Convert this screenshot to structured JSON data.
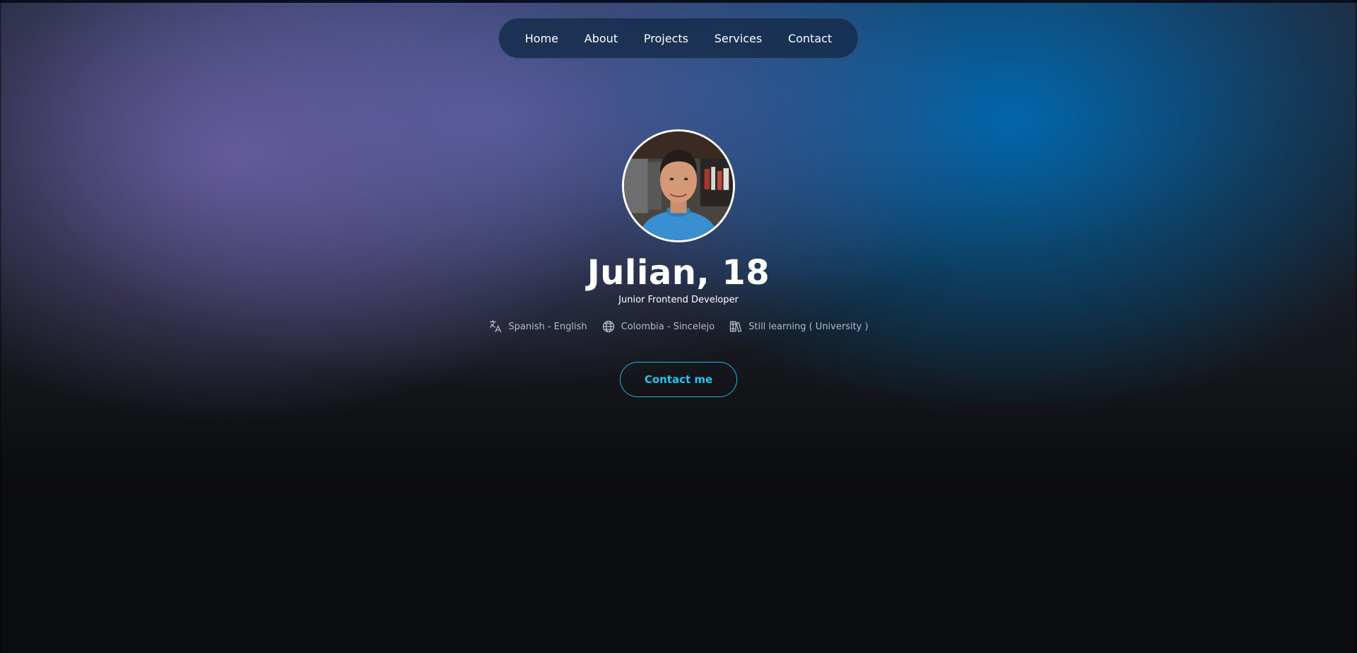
{
  "nav": {
    "items": [
      {
        "label": "Home"
      },
      {
        "label": "About"
      },
      {
        "label": "Projects"
      },
      {
        "label": "Services"
      },
      {
        "label": "Contact"
      }
    ]
  },
  "profile": {
    "name": "Julian, 18",
    "role": "Junior Frontend Developer",
    "info": [
      {
        "icon": "translate-icon",
        "text": "Spanish - English"
      },
      {
        "icon": "globe-icon",
        "text": "Colombia - Sincelejo"
      },
      {
        "icon": "books-icon",
        "text": "Still learning ( University )"
      }
    ],
    "cta_label": "Contact me"
  },
  "colors": {
    "accent": "#27c3ef",
    "nav_background": "#162d4b",
    "text_muted": "#b4bac6"
  }
}
